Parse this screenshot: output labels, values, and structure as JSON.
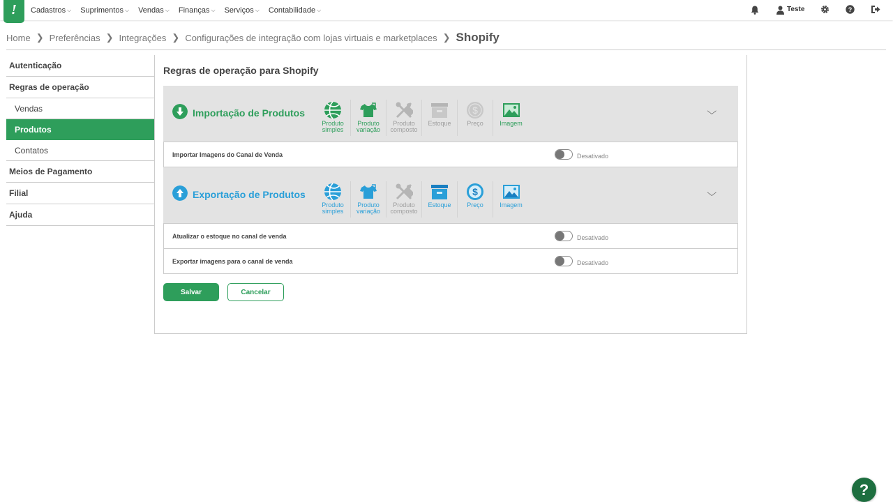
{
  "logo_text": "!",
  "menu": [
    {
      "label": "Cadastros"
    },
    {
      "label": "Suprimentos"
    },
    {
      "label": "Vendas"
    },
    {
      "label": "Finanças"
    },
    {
      "label": "Serviços"
    },
    {
      "label": "Contabilidade"
    }
  ],
  "user": {
    "name": "Teste"
  },
  "top_icons": [
    "bell-icon",
    "user-icon",
    "gear-icon",
    "help-icon",
    "logout-icon"
  ],
  "breadcrumb": {
    "items": [
      "Home",
      "Preferências",
      "Integrações",
      "Configurações de integração com lojas virtuais e marketplaces"
    ],
    "current": "Shopify"
  },
  "sidebar": {
    "items": [
      {
        "label": "Autenticação"
      },
      {
        "label": "Regras de operação"
      },
      {
        "label": "Vendas"
      },
      {
        "label": "Produtos"
      },
      {
        "label": "Contatos"
      },
      {
        "label": "Meios de Pagamento"
      },
      {
        "label": "Filial"
      },
      {
        "label": "Ajuda"
      }
    ]
  },
  "panel": {
    "title": "Regras de operação para Shopify",
    "import": {
      "title": "Importação de Produtos",
      "color": "#2e9e5b",
      "types": [
        {
          "line1": "Produto",
          "line2": "simples",
          "icon": "ball-icon",
          "active": true
        },
        {
          "line1": "Produto",
          "line2": "variação",
          "icon": "tshirt-icon",
          "active": true
        },
        {
          "line1": "Produto",
          "line2": "composto",
          "icon": "tools-icon",
          "active": false
        },
        {
          "line1": "Estoque",
          "line2": "",
          "icon": "box-icon",
          "active": false
        },
        {
          "line1": "Preço",
          "line2": "",
          "icon": "dollar-icon",
          "active": false
        },
        {
          "line1": "Imagem",
          "line2": "",
          "icon": "image-icon",
          "active": true
        }
      ],
      "rows": [
        {
          "label": "Importar Imagens do Canal de Venda",
          "status": "Desativado"
        }
      ]
    },
    "export": {
      "title": "Exportação de Produtos",
      "color": "#2a9fd8",
      "types": [
        {
          "line1": "Produto",
          "line2": "simples",
          "icon": "ball-icon",
          "active": true
        },
        {
          "line1": "Produto",
          "line2": "variação",
          "icon": "tshirt-icon",
          "active": true
        },
        {
          "line1": "Produto",
          "line2": "composto",
          "icon": "tools-icon",
          "active": false
        },
        {
          "line1": "Estoque",
          "line2": "",
          "icon": "box-icon",
          "active": true
        },
        {
          "line1": "Preço",
          "line2": "",
          "icon": "dollar-icon",
          "active": true
        },
        {
          "line1": "Imagem",
          "line2": "",
          "icon": "image-icon",
          "active": true
        }
      ],
      "rows": [
        {
          "label": "Atualizar o estoque no canal de venda",
          "status": "Desativado"
        },
        {
          "label": "Exportar imagens para o canal de venda",
          "status": "Desativado"
        }
      ]
    },
    "save_label": "Salvar",
    "cancel_label": "Cancelar"
  },
  "help_fab": "?",
  "colors": {
    "primary_green": "#2e9e5b",
    "export_blue": "#2a9fd8",
    "inactive_gray": "#9e9e9e"
  }
}
